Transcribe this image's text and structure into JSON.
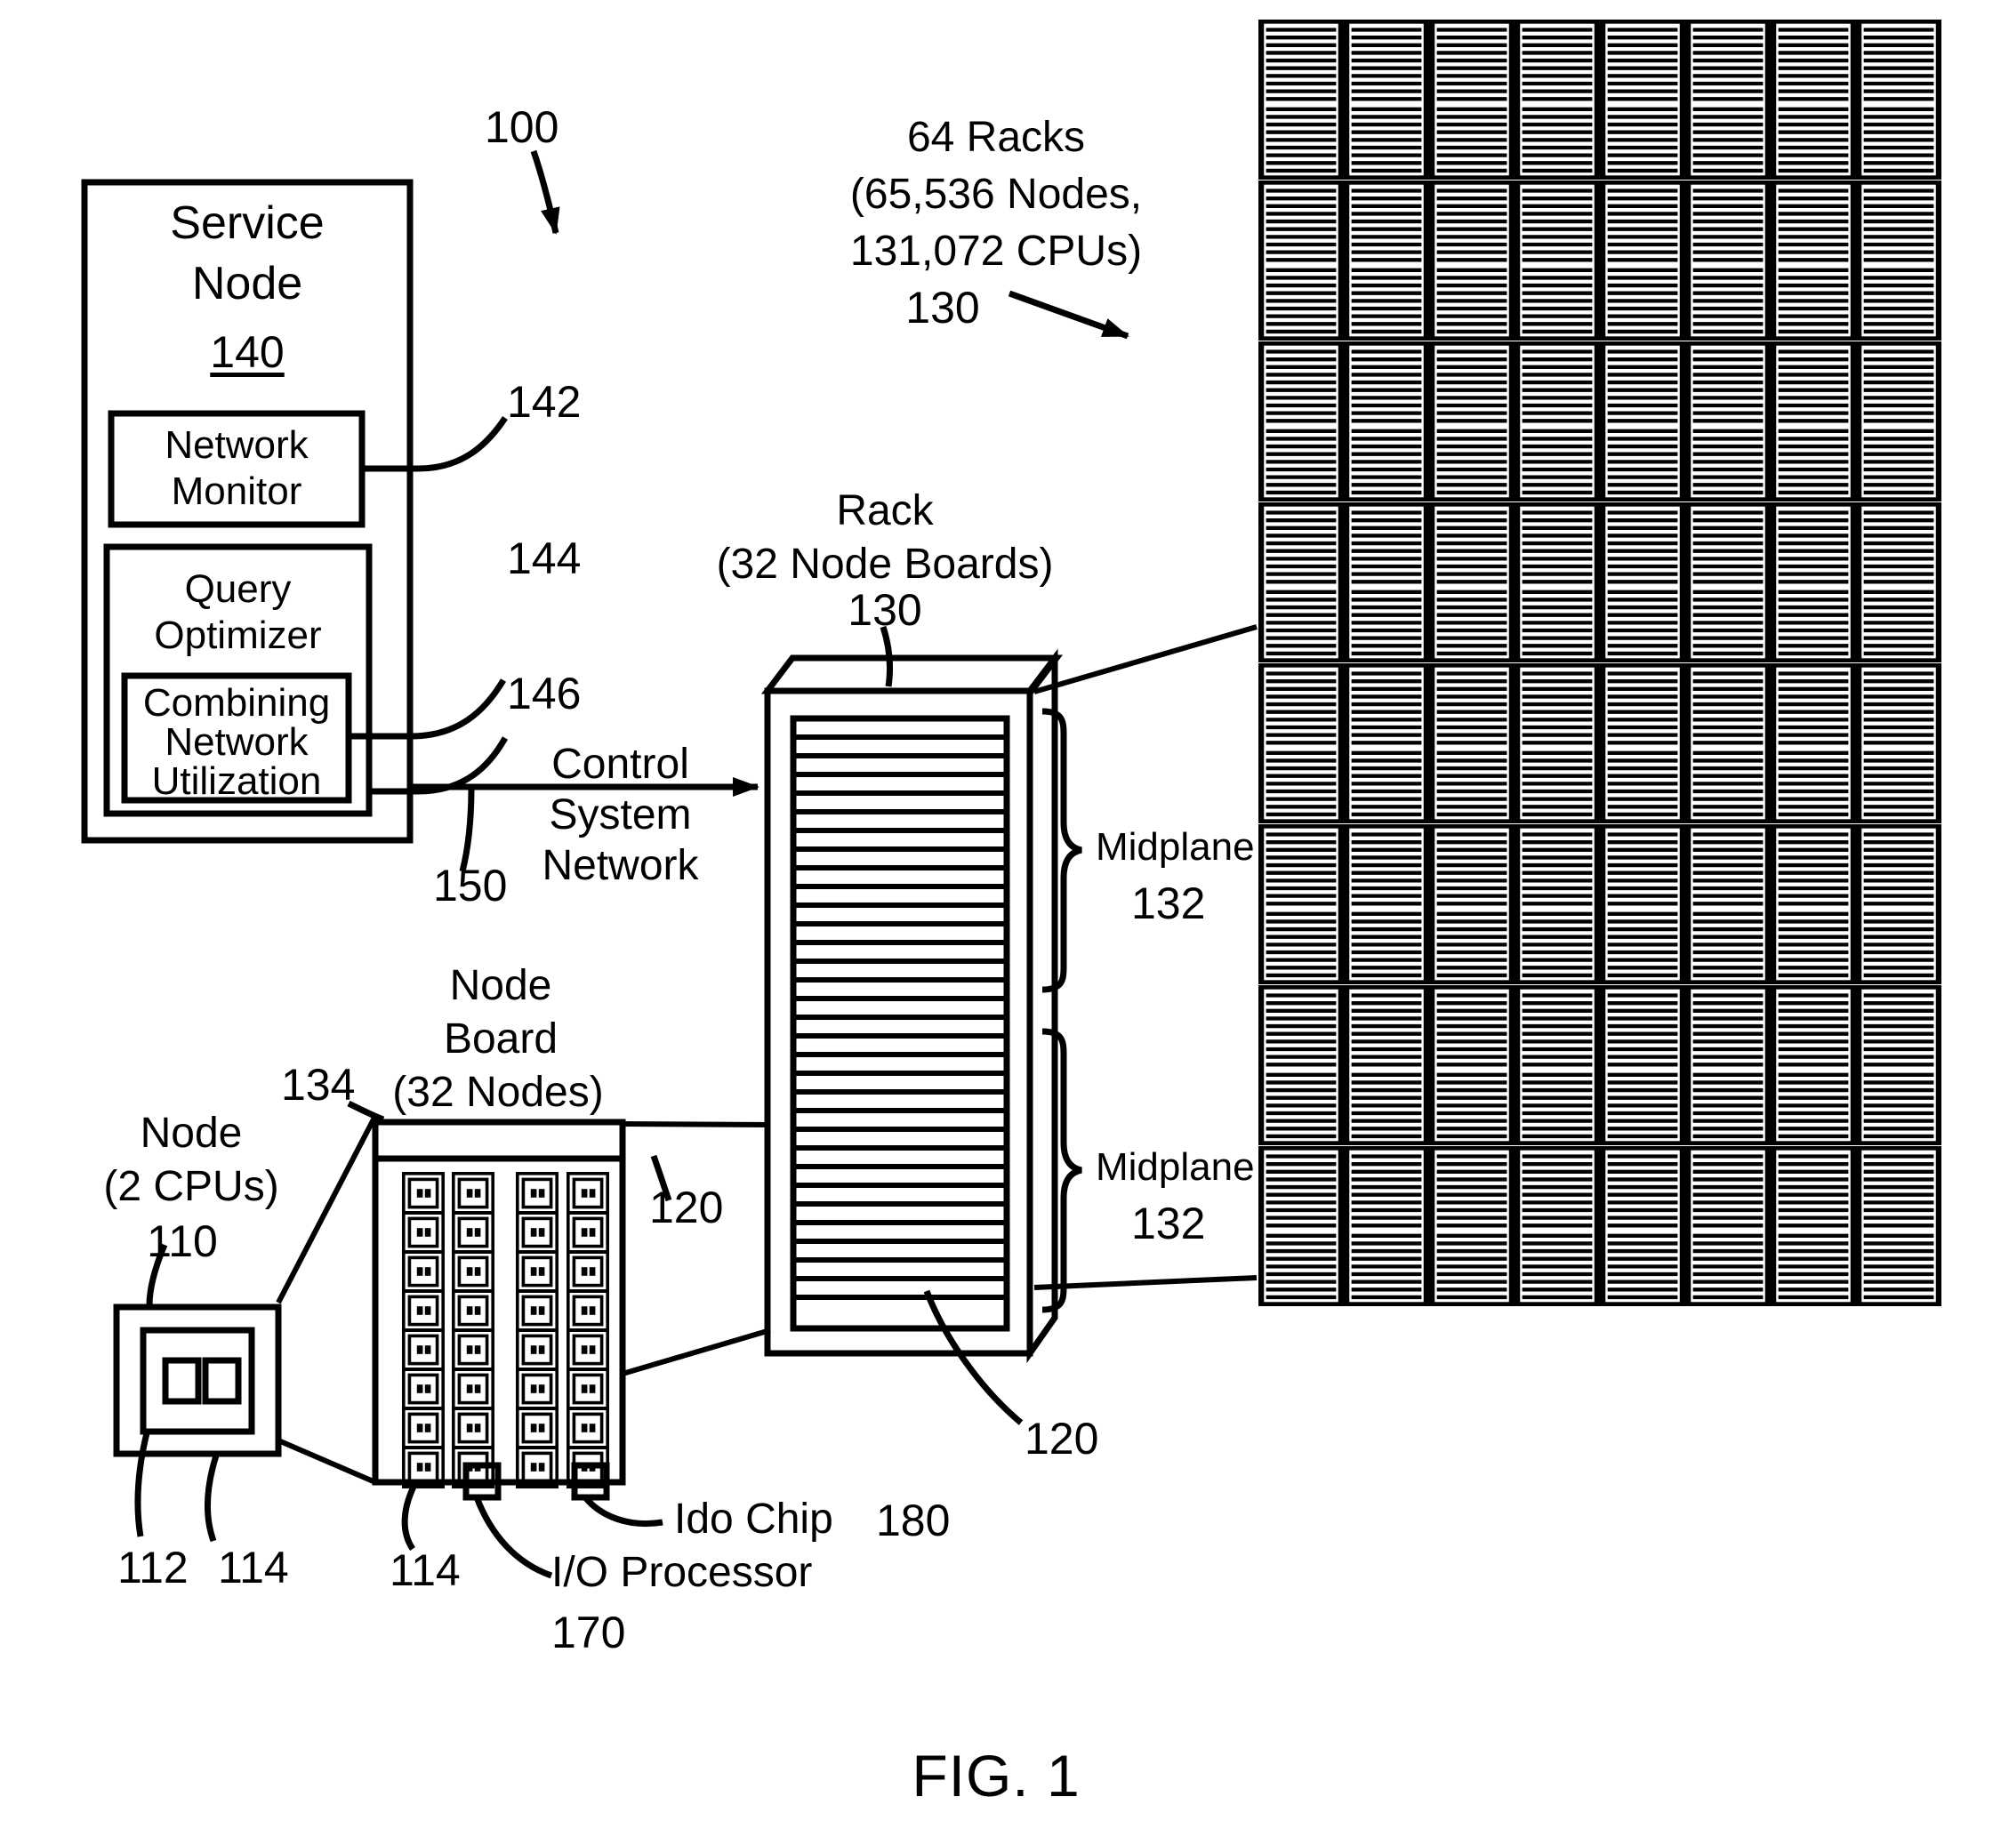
{
  "figure": {
    "caption": "FIG. 1",
    "system_ref": "100"
  },
  "service_node": {
    "title_line1": "Service",
    "title_line2": "Node",
    "ref": "140",
    "blocks": [
      {
        "label_line1": "Network",
        "label_line2": "Monitor",
        "ref": "142"
      },
      {
        "label_line1": "Query",
        "label_line2": "Optimizer",
        "ref": "144"
      },
      {
        "label_line1": "Combining",
        "label_line2": "Network",
        "label_line3": "Utilization",
        "ref": "146"
      }
    ]
  },
  "control_network": {
    "label_line1": "Control",
    "label_line2": "System",
    "label_line3": "Network",
    "ref": "150"
  },
  "rack": {
    "title": "Rack",
    "subtitle": "(32 Node Boards)",
    "ref": "130",
    "board_ref_top": "120",
    "board_ref_bottom": "120",
    "midplane_upper": {
      "label": "Midplane",
      "ref": "132"
    },
    "midplane_lower": {
      "label": "Midplane",
      "ref": "132"
    },
    "node_board_count": 32
  },
  "rack_array": {
    "title_line1": "64 Racks",
    "title_line2": "(65,536 Nodes,",
    "title_line3": "131,072 CPUs)",
    "ref": "130",
    "rows": 8,
    "columns": 8
  },
  "node_board": {
    "title_line1": "Node",
    "title_line2": "Board",
    "title_line3": "(32 Nodes)",
    "ref": "134",
    "chip_ref": "114",
    "grid_columns": 4,
    "grid_rows": 8,
    "io_processor": {
      "label": "I/O Processor",
      "ref": "170"
    },
    "ido_chip": {
      "label": "Ido Chip",
      "ref": "180"
    }
  },
  "node": {
    "title_line1": "Node",
    "title_line2": "(2 CPUs)",
    "ref": "110",
    "cpu_ref": "112",
    "chip_ref": "114"
  },
  "colors": {
    "ink": "#000000",
    "paper": "#ffffff"
  }
}
